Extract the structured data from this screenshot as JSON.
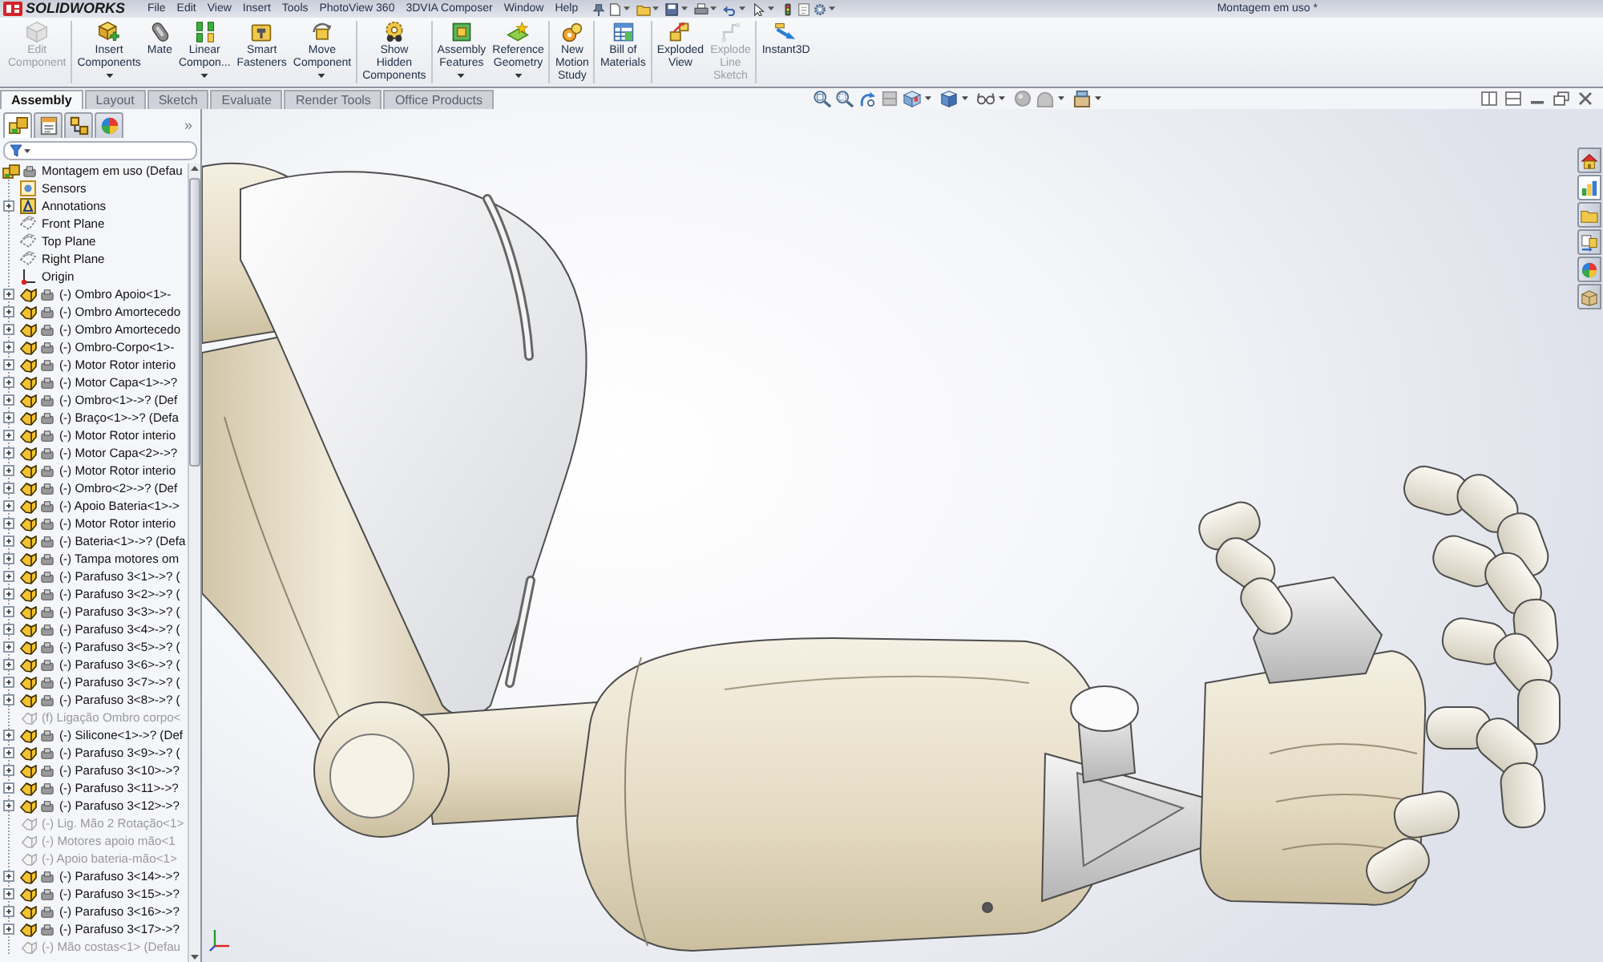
{
  "app": {
    "logo": "SOLIDWORKS",
    "document_title": "Montagem em uso *"
  },
  "menu": [
    "File",
    "Edit",
    "View",
    "Insert",
    "Tools",
    "PhotoView 360",
    "3DVIA Composer",
    "Window",
    "Help"
  ],
  "ribbon": {
    "groups": [
      {
        "buttons": [
          {
            "kind": "edit_component",
            "label": "Edit\nComponent",
            "disabled": true,
            "dropdown": false
          }
        ]
      },
      {
        "buttons": [
          {
            "kind": "insert_components",
            "label": "Insert\nComponents",
            "disabled": false,
            "dropdown": true
          },
          {
            "kind": "mate",
            "label": "Mate",
            "disabled": false,
            "dropdown": false
          },
          {
            "kind": "linear_pattern",
            "label": "Linear\nCompon...",
            "disabled": false,
            "dropdown": true
          },
          {
            "kind": "smart_fasteners",
            "label": "Smart\nFasteners",
            "disabled": false,
            "dropdown": false
          },
          {
            "kind": "move_component",
            "label": "Move\nComponent",
            "disabled": false,
            "dropdown": true
          }
        ]
      },
      {
        "buttons": [
          {
            "kind": "show_hidden",
            "label": "Show\nHidden\nComponents",
            "disabled": false,
            "dropdown": false
          }
        ]
      },
      {
        "buttons": [
          {
            "kind": "assembly_features",
            "label": "Assembly\nFeatures",
            "disabled": false,
            "dropdown": true
          },
          {
            "kind": "reference_geometry",
            "label": "Reference\nGeometry",
            "disabled": false,
            "dropdown": true
          }
        ]
      },
      {
        "buttons": [
          {
            "kind": "motion_study",
            "label": "New\nMotion\nStudy",
            "disabled": false,
            "dropdown": false
          }
        ]
      },
      {
        "buttons": [
          {
            "kind": "bom",
            "label": "Bill of\nMaterials",
            "disabled": false,
            "dropdown": false
          }
        ]
      },
      {
        "buttons": [
          {
            "kind": "exploded_view",
            "label": "Exploded\nView",
            "disabled": false,
            "dropdown": false
          },
          {
            "kind": "explode_line_sketch",
            "label": "Explode\nLine\nSketch",
            "disabled": true,
            "dropdown": false
          }
        ]
      },
      {
        "buttons": [
          {
            "kind": "instant3d",
            "label": "Instant3D",
            "disabled": false,
            "dropdown": false
          }
        ]
      }
    ]
  },
  "command_tabs": [
    {
      "label": "Assembly",
      "selected": true
    },
    {
      "label": "Layout",
      "selected": false
    },
    {
      "label": "Sketch",
      "selected": false
    },
    {
      "label": "Evaluate",
      "selected": false
    },
    {
      "label": "Render Tools",
      "selected": false
    },
    {
      "label": "Office Products",
      "selected": false
    }
  ],
  "view_toolbar": [
    {
      "kind": "zoom_fit",
      "dropdown": false
    },
    {
      "kind": "zoom_area",
      "dropdown": false
    },
    {
      "kind": "previous_view",
      "dropdown": false
    },
    {
      "kind": "section_view",
      "dropdown": false
    },
    {
      "kind": "view_orientation",
      "dropdown": true
    },
    {
      "kind": "display_style",
      "dropdown": true
    },
    {
      "kind": "hide_show",
      "dropdown": true
    },
    {
      "kind": "edit_appearance",
      "dropdown": false
    },
    {
      "kind": "apply_scene",
      "dropdown": true
    },
    {
      "kind": "view_settings",
      "dropdown": true
    }
  ],
  "feature_tree": {
    "tabs": [
      {
        "kind": "tree",
        "selected": true
      },
      {
        "kind": "properties",
        "selected": false
      },
      {
        "kind": "configurations",
        "selected": false
      },
      {
        "kind": "display",
        "selected": false
      }
    ],
    "more": "»",
    "root": {
      "label": "Montagem em uso (Defau",
      "children": [
        {
          "kind": "sensors",
          "label": "Sensors",
          "expandable": false,
          "suppressed": false
        },
        {
          "kind": "annotations",
          "label": "Annotations",
          "expandable": true,
          "suppressed": false
        },
        {
          "kind": "plane",
          "label": "Front Plane",
          "expandable": false,
          "suppressed": false
        },
        {
          "kind": "plane",
          "label": "Top Plane",
          "expandable": false,
          "suppressed": false
        },
        {
          "kind": "plane",
          "label": "Right Plane",
          "expandable": false,
          "suppressed": false
        },
        {
          "kind": "origin",
          "label": "Origin",
          "expandable": false,
          "suppressed": false
        },
        {
          "kind": "component",
          "label": "(-) Ombro Apoio<1>-",
          "expandable": true,
          "suppressed": false
        },
        {
          "kind": "component",
          "label": "(-) Ombro Amortecedo",
          "expandable": true,
          "suppressed": false
        },
        {
          "kind": "component",
          "label": "(-) Ombro Amortecedo",
          "expandable": true,
          "suppressed": false
        },
        {
          "kind": "component",
          "label": "(-) Ombro-Corpo<1>-",
          "expandable": true,
          "suppressed": false
        },
        {
          "kind": "component",
          "label": "(-) Motor Rotor interio",
          "expandable": true,
          "suppressed": false
        },
        {
          "kind": "component",
          "label": "(-) Motor Capa<1>->?",
          "expandable": true,
          "suppressed": false
        },
        {
          "kind": "component",
          "label": "(-) Ombro<1>->? (Def",
          "expandable": true,
          "suppressed": false
        },
        {
          "kind": "component",
          "label": "(-) Braço<1>->? (Defa",
          "expandable": true,
          "suppressed": false
        },
        {
          "kind": "component",
          "label": "(-) Motor Rotor interio",
          "expandable": true,
          "suppressed": false
        },
        {
          "kind": "component",
          "label": "(-) Motor Capa<2>->?",
          "expandable": true,
          "suppressed": false
        },
        {
          "kind": "component",
          "label": "(-) Motor Rotor interio",
          "expandable": true,
          "suppressed": false
        },
        {
          "kind": "component",
          "label": "(-) Ombro<2>->? (Def",
          "expandable": true,
          "suppressed": false
        },
        {
          "kind": "component",
          "label": "(-) Apoio Bateria<1>->",
          "expandable": true,
          "suppressed": false
        },
        {
          "kind": "component",
          "label": "(-) Motor Rotor interio",
          "expandable": true,
          "suppressed": false
        },
        {
          "kind": "component",
          "label": "(-) Bateria<1>->? (Defa",
          "expandable": true,
          "suppressed": false
        },
        {
          "kind": "component",
          "label": "(-) Tampa motores om",
          "expandable": true,
          "suppressed": false
        },
        {
          "kind": "component",
          "label": "(-) Parafuso 3<1>->? (",
          "expandable": true,
          "suppressed": false
        },
        {
          "kind": "component",
          "label": "(-) Parafuso 3<2>->? (",
          "expandable": true,
          "suppressed": false
        },
        {
          "kind": "component",
          "label": "(-) Parafuso 3<3>->? (",
          "expandable": true,
          "suppressed": false
        },
        {
          "kind": "component",
          "label": "(-) Parafuso 3<4>->? (",
          "expandable": true,
          "suppressed": false
        },
        {
          "kind": "component",
          "label": "(-) Parafuso 3<5>->? (",
          "expandable": true,
          "suppressed": false
        },
        {
          "kind": "component",
          "label": "(-) Parafuso 3<6>->? (",
          "expandable": true,
          "suppressed": false
        },
        {
          "kind": "component",
          "label": "(-) Parafuso 3<7>->? (",
          "expandable": true,
          "suppressed": false
        },
        {
          "kind": "component",
          "label": "(-) Parafuso 3<8>->? (",
          "expandable": true,
          "suppressed": false
        },
        {
          "kind": "component",
          "label": "(f) Ligação Ombro corpo<",
          "expandable": false,
          "suppressed": true
        },
        {
          "kind": "component",
          "label": "(-) Silicone<1>->? (Def",
          "expandable": true,
          "suppressed": false
        },
        {
          "kind": "component",
          "label": "(-) Parafuso 3<9>->? (",
          "expandable": true,
          "suppressed": false
        },
        {
          "kind": "component",
          "label": "(-) Parafuso 3<10>->?",
          "expandable": true,
          "suppressed": false
        },
        {
          "kind": "component",
          "label": "(-) Parafuso 3<11>->?",
          "expandable": true,
          "suppressed": false
        },
        {
          "kind": "component",
          "label": "(-) Parafuso 3<12>->?",
          "expandable": true,
          "suppressed": false
        },
        {
          "kind": "component",
          "label": "(-) Lig. Mão 2 Rotação<1>",
          "expandable": false,
          "suppressed": true
        },
        {
          "kind": "component",
          "label": "(-) Motores apoio mão<1",
          "expandable": false,
          "suppressed": true
        },
        {
          "kind": "component",
          "label": "(-) Apoio bateria-mão<1>",
          "expandable": false,
          "suppressed": true
        },
        {
          "kind": "component",
          "label": "(-) Parafuso 3<14>->?",
          "expandable": true,
          "suppressed": false
        },
        {
          "kind": "component",
          "label": "(-) Parafuso 3<15>->?",
          "expandable": true,
          "suppressed": false
        },
        {
          "kind": "component",
          "label": "(-) Parafuso 3<16>->?",
          "expandable": true,
          "suppressed": false
        },
        {
          "kind": "component",
          "label": "(-) Parafuso 3<17>->?",
          "expandable": true,
          "suppressed": false
        },
        {
          "kind": "component",
          "label": "(-) Mão costas<1> (Defau",
          "expandable": false,
          "suppressed": true
        }
      ]
    }
  },
  "task_pane": [
    {
      "kind": "home",
      "selected": false
    },
    {
      "kind": "resources",
      "selected": true
    },
    {
      "kind": "library",
      "selected": false
    },
    {
      "kind": "explorer",
      "selected": false
    },
    {
      "kind": "appearances",
      "selected": false
    },
    {
      "kind": "properties",
      "selected": false
    }
  ]
}
